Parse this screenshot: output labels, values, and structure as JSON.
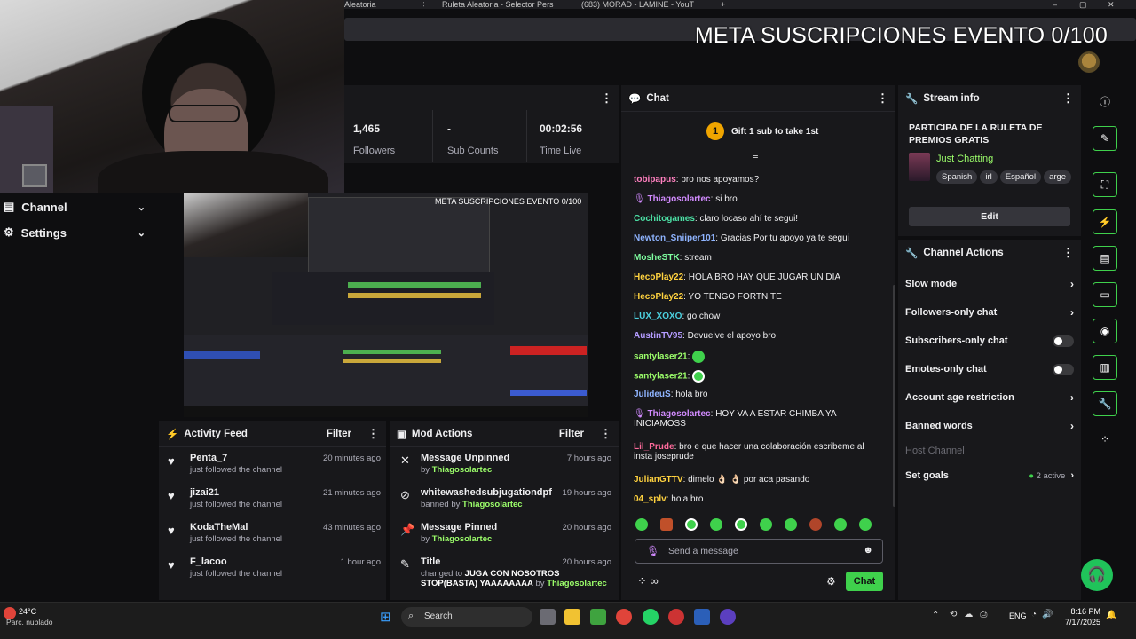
{
  "browser": {
    "tabs": [
      "Aleatoria",
      "Ruleta Aleatoria - Selector Pers",
      "(683) MORAD - LAMINE - YouT"
    ]
  },
  "overlay": {
    "title": "META SUSCRIPCIONES EVENTO 0/100"
  },
  "left_nav": {
    "items": [
      {
        "label": "Channel"
      },
      {
        "label": "Settings"
      }
    ]
  },
  "stats": [
    {
      "value": "1,465",
      "label": "Followers"
    },
    {
      "value": "-",
      "label": "Sub Counts"
    },
    {
      "value": "00:02:56",
      "label": "Time Live"
    }
  ],
  "preview": {
    "overlay_title": "META SUSCRIPCIONES EVENTO 0/100"
  },
  "activity_feed": {
    "title": "Activity Feed",
    "filter_label": "Filter",
    "items": [
      {
        "name": "Penta_7",
        "sub": "just followed the channel",
        "time": "20 minutes ago"
      },
      {
        "name": "jizai21",
        "sub": "just followed the channel",
        "time": "21 minutes ago"
      },
      {
        "name": "KodaTheMal",
        "sub": "just followed the channel",
        "time": "43 minutes ago"
      },
      {
        "name": "F_lacoo",
        "sub": "just followed the channel",
        "time": "1 hour ago"
      }
    ]
  },
  "mod_actions": {
    "title": "Mod Actions",
    "filter_label": "Filter",
    "items": [
      {
        "action": "Message Unpinned",
        "by_prefix": "by",
        "by": "Thiagosolartec",
        "time": "7 hours ago"
      },
      {
        "action": "whitewashedsubjugationdpf",
        "by_prefix": "banned by",
        "by": "Thiagosolartec",
        "time": "19 hours ago"
      },
      {
        "action": "Message Pinned",
        "by_prefix": "by",
        "by": "Thiagosolartec",
        "time": "20 hours ago"
      },
      {
        "action": "Title",
        "by_prefix": "changed to",
        "detail": "JUGA CON NOSOTROS STOP(BASTA) YAAAAAAAA",
        "detail_by": "by",
        "by": "Thiagosolartec",
        "time": "20 hours ago"
      }
    ]
  },
  "chat": {
    "title": "Chat",
    "gift_count": "1",
    "gift_label": "Gift 1 sub to take 1st",
    "messages": [
      {
        "user": "tobipapus",
        "color": "#ff7fbf",
        "text": "bro nos apoyamos?"
      },
      {
        "user": "Thiagosolartec",
        "color": "#d28bff",
        "text": "si bro"
      },
      {
        "user": "Cochitogames",
        "color": "#4ce0a5",
        "text": "claro locaso ahí te segui!"
      },
      {
        "user": "Newton_Sniiper101",
        "color": "#8fb4ff",
        "text": "Gracias Por tu apoyo ya te segui"
      },
      {
        "user": "MosheSTK",
        "color": "#7fffa0",
        "text": "stream"
      },
      {
        "user": "HecoPlay22",
        "color": "#ffd23f",
        "text": "HOLA BRO HAY QUE JUGAR UN DIA"
      },
      {
        "user": "HecoPlay22",
        "color": "#ffd23f",
        "text": "YO TENGO FORTNITE"
      },
      {
        "user": "LUX_XOXO",
        "color": "#4cd1e0",
        "text": "go chow"
      },
      {
        "user": "AustinTV95",
        "color": "#b39bff",
        "text": "Devuelve el apoyo bro"
      },
      {
        "user": "santylaser21",
        "color": "#9cff6b",
        "text": ""
      },
      {
        "user": "santylaser21",
        "color": "#9cff6b",
        "text": ""
      },
      {
        "user": "JulideuS",
        "color": "#8fb4ff",
        "text": "hola bro"
      },
      {
        "user": "Thiagosolartec",
        "color": "#d28bff",
        "text": "HOY VA A ESTAR CHIMBA YA",
        "text2": "INICIAMOSS"
      },
      {
        "user": "Lil_Prude",
        "color": "#ff6b9c",
        "text": "bro e que hacer una colaboración escribeme al",
        "text2": "insta joseprude"
      },
      {
        "user": "JulianGTTV",
        "color": "#ffd23f",
        "text": "dimelo 👌🏻 👌🏻 por aca pasando"
      },
      {
        "user": "04_splv",
        "color": "#ffd23f",
        "text": "hola bro"
      }
    ],
    "input_placeholder": "Send a message",
    "chat_button": "Chat"
  },
  "stream_info": {
    "title": "Stream info",
    "stream_title": "PARTICIPA DE LA RULETA DE PREMIOS GRATIS",
    "category": "Just Chatting",
    "tags": [
      "Spanish",
      "irl",
      "Español",
      "arge"
    ],
    "edit_label": "Edit"
  },
  "channel_actions": {
    "title": "Channel Actions",
    "items": [
      {
        "label": "Slow mode",
        "control": "chevron"
      },
      {
        "label": "Followers-only chat",
        "control": "chevron"
      },
      {
        "label": "Subscribers-only chat",
        "control": "toggle"
      },
      {
        "label": "Emotes-only chat",
        "control": "toggle"
      },
      {
        "label": "Account age restriction",
        "control": "chevron"
      },
      {
        "label": "Banned words",
        "control": "chevron"
      },
      {
        "label": "Host Channel",
        "control": "disabled"
      },
      {
        "label": "Set goals",
        "control": "chevron",
        "badge": "2 active"
      }
    ]
  },
  "taskbar": {
    "weather_temp": "24°C",
    "weather_desc": "Parc. nublado",
    "search_label": "Search",
    "lang": "ENG",
    "time": "8:16 PM",
    "date": "7/17/2025"
  },
  "colors": {
    "accent": "#3fd14c",
    "panel": "#18181b",
    "bg": "#0e0e10"
  }
}
